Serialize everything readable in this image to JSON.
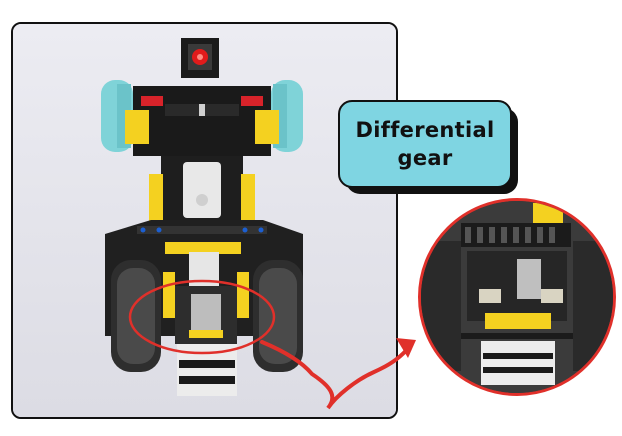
{
  "callout": {
    "line1": "Differential",
    "line2": "gear"
  },
  "colors": {
    "callout_fill": "#7fd5e2",
    "highlight_red": "#e0302a",
    "frame_border": "#111111",
    "robot_yellow": "#f4d120",
    "robot_cyan": "#7fd3d8"
  },
  "icons": {
    "arrow": "curved-arrow-icon",
    "highlight": "ellipse-highlight-icon"
  }
}
